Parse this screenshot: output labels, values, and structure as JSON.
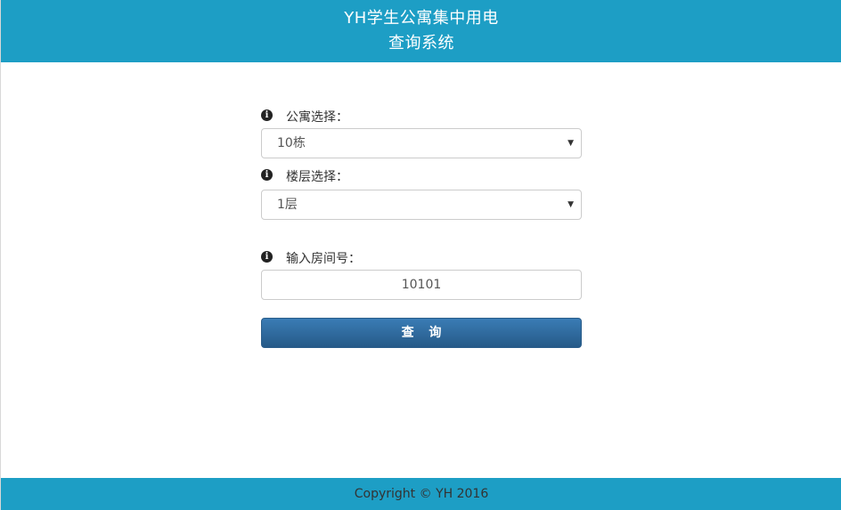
{
  "header": {
    "title_line1": "YH学生公寓集中用电",
    "title_line2": "查询系统"
  },
  "form": {
    "apartment": {
      "label": "公寓选择：",
      "selected": "10栋",
      "icon": "info-icon"
    },
    "floor": {
      "label": "楼层选择：",
      "selected": "1层",
      "icon": "info-icon"
    },
    "room": {
      "label": "输入房间号：",
      "value": "10101",
      "icon": "info-icon"
    },
    "submit_label": "查 询"
  },
  "footer": {
    "copyright": "Copyright © YH 2016"
  },
  "colors": {
    "header_bg": "#1d9ec5",
    "button_bg": "#2f6ea5"
  }
}
